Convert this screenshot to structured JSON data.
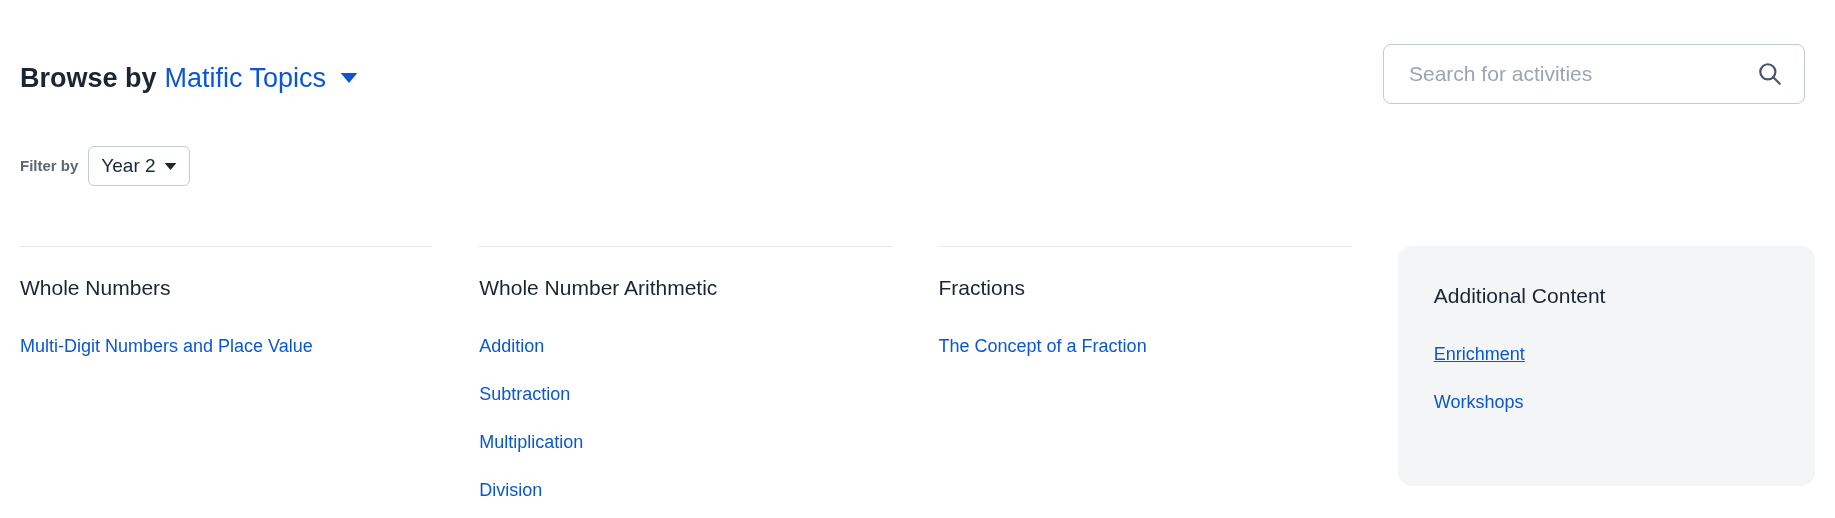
{
  "header": {
    "title": "Browse by",
    "topic_selector": "Matific Topics"
  },
  "search": {
    "placeholder": "Search for activities"
  },
  "filter": {
    "label": "Filter by",
    "value": "Year 2"
  },
  "columns": [
    {
      "heading": "Whole Numbers",
      "links": [
        {
          "label": "Multi-Digit Numbers and Place Value",
          "hovered": false
        }
      ]
    },
    {
      "heading": "Whole Number Arithmetic",
      "links": [
        {
          "label": "Addition",
          "hovered": false
        },
        {
          "label": "Subtraction",
          "hovered": false
        },
        {
          "label": "Multiplication",
          "hovered": false
        },
        {
          "label": "Division",
          "hovered": false
        }
      ]
    },
    {
      "heading": "Fractions",
      "links": [
        {
          "label": "The Concept of a Fraction",
          "hovered": false
        }
      ]
    }
  ],
  "additional": {
    "heading": "Additional Content",
    "links": [
      {
        "label": "Enrichment",
        "hovered": true
      },
      {
        "label": "Workshops",
        "hovered": false
      }
    ]
  }
}
